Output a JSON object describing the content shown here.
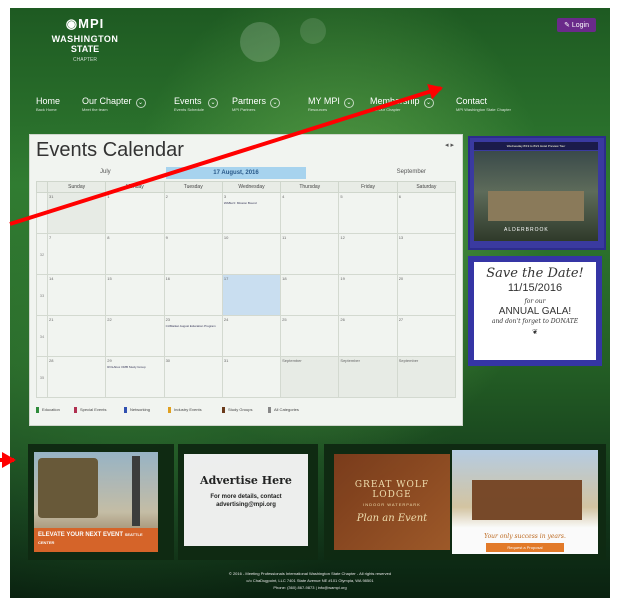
{
  "site": {
    "logo": {
      "mark": "◉MPI",
      "line1": "WASHINGTON",
      "line2": "STATE",
      "line3": "CHAPTER"
    },
    "login_label": "✎ Login"
  },
  "nav": {
    "items": [
      {
        "label": "Home",
        "sub": "Back Home"
      },
      {
        "label": "Our Chapter",
        "sub": "Meet the team"
      },
      {
        "label": "Events",
        "sub": "Events Schedule"
      },
      {
        "label": "Partners",
        "sub": "MPI Partners"
      },
      {
        "label": "MY MPI",
        "sub": "Resources"
      },
      {
        "label": "Membership",
        "sub": "Join Our Chapter"
      },
      {
        "label": "Contact",
        "sub": "MPI Washington State Chapter"
      }
    ]
  },
  "calendar": {
    "title": "Events Calendar",
    "controls": "◂ ▸",
    "prev_label": "July",
    "current_label": "17 August, 2016",
    "next_label": "September",
    "weekdays": [
      "Sunday",
      "Monday",
      "Tuesday",
      "Wednesday",
      "Thursday",
      "Friday",
      "Saturday"
    ],
    "weeks": [
      {
        "wk": "31",
        "days": [
          {
            "n": "31"
          },
          {
            "n": "1"
          },
          {
            "n": "2"
          },
          {
            "n": "3",
            "ev": "WABuzz: Mission Bound"
          },
          {
            "n": "4"
          },
          {
            "n": "5"
          },
          {
            "n": "6"
          }
        ]
      },
      {
        "wk": "32",
        "days": [
          {
            "n": "7"
          },
          {
            "n": "8"
          },
          {
            "n": "9"
          },
          {
            "n": "10"
          },
          {
            "n": "11"
          },
          {
            "n": "12"
          },
          {
            "n": "13"
          }
        ]
      },
      {
        "wk": "33",
        "days": [
          {
            "n": "14"
          },
          {
            "n": "15"
          },
          {
            "n": "16"
          },
          {
            "n": "17"
          },
          {
            "n": "18"
          },
          {
            "n": "19"
          },
          {
            "n": "20"
          }
        ]
      },
      {
        "wk": "34",
        "days": [
          {
            "n": "21"
          },
          {
            "n": "22"
          },
          {
            "n": "23",
            "ev": "CUMarket August Education Program"
          },
          {
            "n": "24"
          },
          {
            "n": "25"
          },
          {
            "n": "26"
          },
          {
            "n": "27"
          }
        ]
      },
      {
        "wk": "35",
        "days": [
          {
            "n": "28"
          },
          {
            "n": "29",
            "ev": "ROLAbox OMB Study Group"
          },
          {
            "n": "30"
          },
          {
            "n": "31"
          },
          {
            "n": "September"
          },
          {
            "n": "September"
          },
          {
            "n": "September"
          }
        ]
      }
    ],
    "legend": [
      {
        "label": "Education",
        "color": "#2e8b3a"
      },
      {
        "label": "Special Events",
        "color": "#b03050"
      },
      {
        "label": "Networking",
        "color": "#3050b0"
      },
      {
        "label": "Industry Events",
        "color": "#e0a020"
      },
      {
        "label": "Study Groups",
        "color": "#6a3a1a"
      },
      {
        "label": "All Categories",
        "color": "#888888"
      }
    ]
  },
  "ads": {
    "right_top": {
      "header": "Wednesday 8/19 to 8/21 Hotel Preview Tour",
      "caption": "ALDERBROOK"
    },
    "right_gala": {
      "a": "Save the Date!",
      "b": "11/15/2016",
      "c": "for our",
      "d": "ANNUAL GALA!",
      "e": "and don't forget to DONATE",
      "f": "❦"
    },
    "bottom_left": {
      "band": "ELEVATE YOUR NEXT EVENT",
      "brand": "SEATTLE CENTER"
    },
    "bottom_mid": {
      "heading": "Advertise Here",
      "sub": "For more details, contact advertising@mpi.org"
    },
    "bottom_right": {
      "heading": "GREAT WOLF LODGE",
      "sub": "INDOOR WATERPARK",
      "script": "Plan an Event",
      "note": "Your only success in years.",
      "button": "Request a Proposal"
    }
  },
  "footer": {
    "line1": "© 2016 - Meeting Professionals International Washington State Chapter - All rights reserved",
    "line2": "c/o ChaDugpoint, LLC 7401 State Avenue NE #101 Olympia, WA 98501",
    "line3": "Phone: (360) 867-9873 | info@wampi.org"
  },
  "accent": {
    "arrow": "#ff0000",
    "ad_blue": "#3535a5",
    "calendar_highlight": "#a7d3ee"
  }
}
